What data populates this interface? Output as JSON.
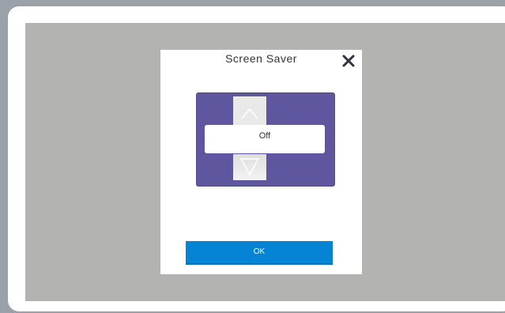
{
  "dialog": {
    "title": "Screen Saver",
    "close_icon": "close-icon",
    "picker": {
      "value": "Off",
      "up_icon": "chevron-up-icon",
      "down_icon": "chevron-down-icon"
    },
    "ok_label": "OK"
  },
  "colors": {
    "outer_background": "#9aa1a9",
    "backdrop": "#b3b4b2",
    "picker_background": "#5e579f",
    "ok_button": "#0584d6"
  }
}
